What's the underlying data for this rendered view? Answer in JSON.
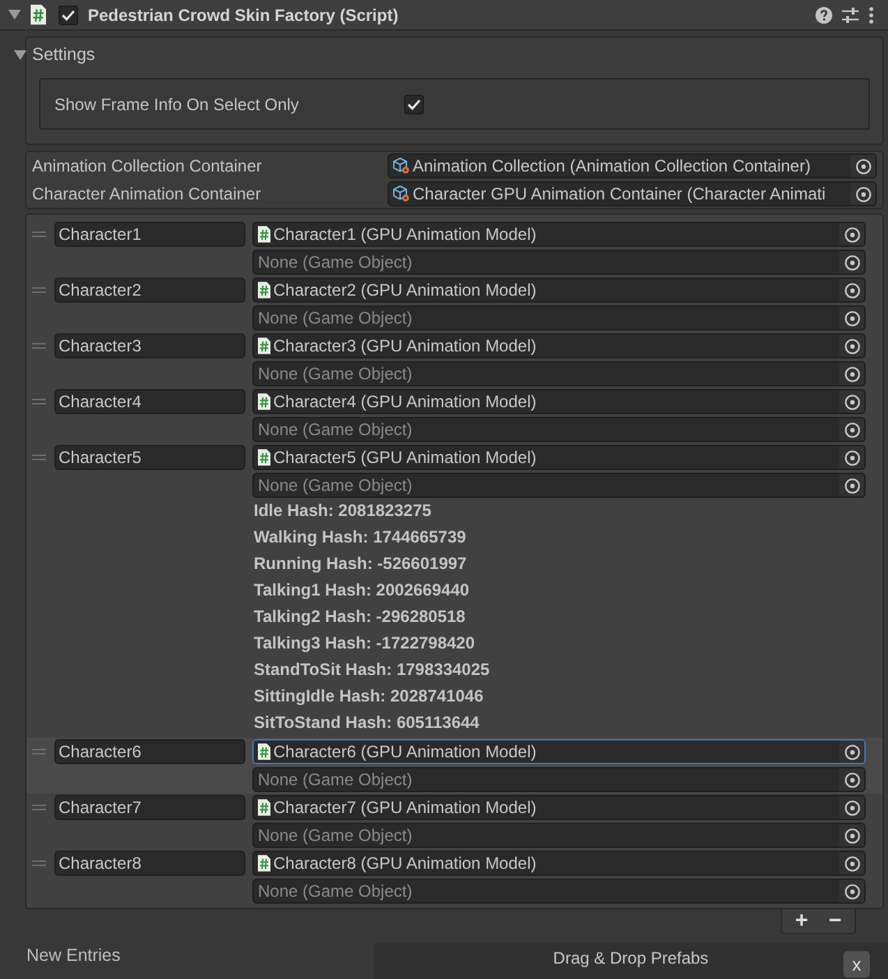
{
  "component": {
    "title": "Pedestrian Crowd Skin Factory (Script)",
    "expanded": true,
    "enabled": true
  },
  "settings": {
    "title": "Settings",
    "expanded": true,
    "show_frame_info": {
      "label": "Show Frame Info On Select Only",
      "checked": true
    }
  },
  "references": [
    {
      "label": "Animation Collection Container",
      "value": "Animation Collection (Animation Collection Container)"
    },
    {
      "label": "Character Animation Container",
      "value": "Character GPU Animation Container (Character Animati"
    }
  ],
  "characters": [
    {
      "name": "Character1",
      "model": "Character1 (GPU Animation Model)",
      "prefab": "None (Game Object)",
      "selected": false
    },
    {
      "name": "Character2",
      "model": "Character2 (GPU Animation Model)",
      "prefab": "None (Game Object)",
      "selected": false
    },
    {
      "name": "Character3",
      "model": "Character3 (GPU Animation Model)",
      "prefab": "None (Game Object)",
      "selected": false
    },
    {
      "name": "Character4",
      "model": "Character4 (GPU Animation Model)",
      "prefab": "None (Game Object)",
      "selected": false
    },
    {
      "name": "Character5",
      "model": "Character5 (GPU Animation Model)",
      "prefab": "None (Game Object)",
      "selected": false,
      "hashes": [
        "Idle Hash: 2081823275",
        "Walking Hash: 1744665739",
        "Running Hash: -526601997",
        "Talking1 Hash: 2002669440",
        "Talking2 Hash: -296280518",
        "Talking3 Hash: -1722798420",
        "StandToSit Hash: 1798334025",
        "SittingIdle Hash: 2028741046",
        "SitToStand Hash: 605113644"
      ]
    },
    {
      "name": "Character6",
      "model": "Character6 (GPU Animation Model)",
      "prefab": "None (Game Object)",
      "selected": true
    },
    {
      "name": "Character7",
      "model": "Character7 (GPU Animation Model)",
      "prefab": "None (Game Object)",
      "selected": false
    },
    {
      "name": "Character8",
      "model": "Character8 (GPU Animation Model)",
      "prefab": "None (Game Object)",
      "selected": false
    }
  ],
  "list_buttons": [
    "+",
    "−"
  ],
  "new_entries": {
    "label": "New Entries",
    "drop_area": "Drag & Drop Prefabs",
    "clear_button": "x"
  }
}
